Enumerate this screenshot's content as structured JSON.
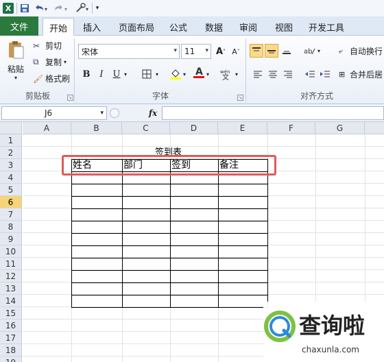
{
  "quick_access": {
    "excel_icon": "X",
    "save_icon": "save-icon",
    "undo_icon": "undo-icon",
    "redo_icon": "redo-icon",
    "customize_icon": "customize-icon"
  },
  "tabs": [
    {
      "label": "文件"
    },
    {
      "label": "开始"
    },
    {
      "label": "插入"
    },
    {
      "label": "页面布局"
    },
    {
      "label": "公式"
    },
    {
      "label": "数据"
    },
    {
      "label": "审阅"
    },
    {
      "label": "视图"
    },
    {
      "label": "开发工具"
    }
  ],
  "ribbon": {
    "clipboard": {
      "paste": "粘贴",
      "cut": "剪切",
      "copy": "复制",
      "format_painter": "格式刷",
      "group": "剪贴板"
    },
    "font": {
      "font_name": "宋体",
      "font_size": "11",
      "bold": "B",
      "italic": "I",
      "underline": "U",
      "group": "字体",
      "grow": "A",
      "shrink": "A"
    },
    "alignment": {
      "wrap_text": "自动换行",
      "merge_center": "合并后居",
      "group": "对齐方式"
    }
  },
  "formula_bar": {
    "name_box": "J6",
    "fx": "fx",
    "value": ""
  },
  "grid": {
    "columns": [
      "A",
      "B",
      "C",
      "D",
      "E",
      "F",
      "G"
    ],
    "rows": [
      "1",
      "2",
      "3",
      "4",
      "5",
      "6",
      "7",
      "8",
      "9",
      "10",
      "11",
      "12",
      "13",
      "14",
      "15",
      "16",
      "17",
      "18",
      "19"
    ],
    "active_row": "6"
  },
  "sheet": {
    "title": "签到表",
    "headers": [
      "姓名",
      "部门",
      "签到",
      "备注"
    ]
  },
  "watermark": {
    "brand": "查询啦",
    "url": "chaxunla.com"
  },
  "colors": {
    "file_tab": "#2b7a3d",
    "highlight": "#e05a5a",
    "active_row": "#f8d478"
  }
}
